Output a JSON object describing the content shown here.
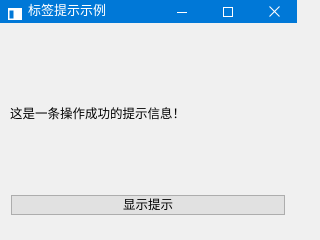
{
  "window": {
    "title": "标签提示示例",
    "controls": {
      "minimize_icon": "minimize-icon",
      "maximize_icon": "maximize-icon",
      "close_icon": "close-icon"
    }
  },
  "main": {
    "message": "这是一条操作成功的提示信息！",
    "button_label": "显示提示"
  },
  "colors": {
    "titlebar": "#0078d7",
    "titlebar_text": "#ffffff",
    "background": "#f0f0f0",
    "button_bg": "#e1e1e1",
    "button_border": "#adadad"
  }
}
